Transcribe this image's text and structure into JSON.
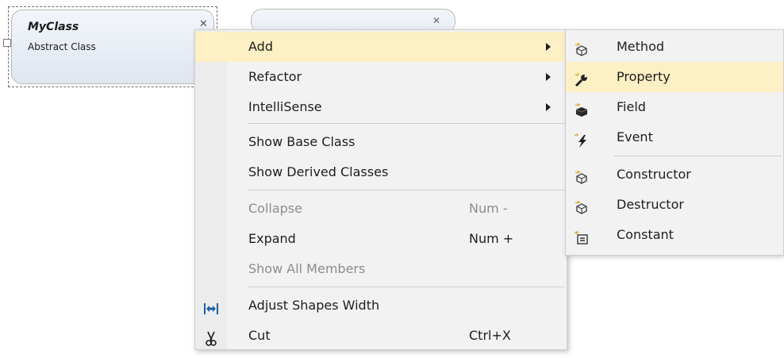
{
  "diagram": {
    "class_name": "MyClass",
    "class_kind": "Abstract Class"
  },
  "menu": {
    "items": [
      {
        "label": "Add",
        "has_submenu": true,
        "highlighted": true
      },
      {
        "label": "Refactor",
        "has_submenu": true
      },
      {
        "label": "IntelliSense",
        "has_submenu": true
      },
      {
        "label": "Show Base Class"
      },
      {
        "label": "Show Derived Classes"
      },
      {
        "label": "Collapse",
        "shortcut": "Num -",
        "disabled": true
      },
      {
        "label": "Expand",
        "shortcut": "Num +"
      },
      {
        "label": "Show All Members",
        "disabled": true
      },
      {
        "label": "Adjust Shapes Width",
        "icon": "adjust-width-icon"
      },
      {
        "label": "Cut",
        "shortcut": "Ctrl+X",
        "icon": "scissors-icon"
      }
    ]
  },
  "submenu": {
    "items": [
      {
        "label": "Method",
        "icon": "method-icon"
      },
      {
        "label": "Property",
        "icon": "property-wrench-icon",
        "highlighted": true
      },
      {
        "label": "Field",
        "icon": "field-icon"
      },
      {
        "label": "Event",
        "icon": "event-lightning-icon"
      },
      {
        "label": "Constructor",
        "icon": "constructor-icon"
      },
      {
        "label": "Destructor",
        "icon": "destructor-icon"
      },
      {
        "label": "Constant",
        "icon": "constant-icon"
      }
    ]
  },
  "colors": {
    "highlight": "#fcf0c4",
    "menu_bg": "#f2f2f2",
    "disabled_text": "#8c8c8c"
  }
}
